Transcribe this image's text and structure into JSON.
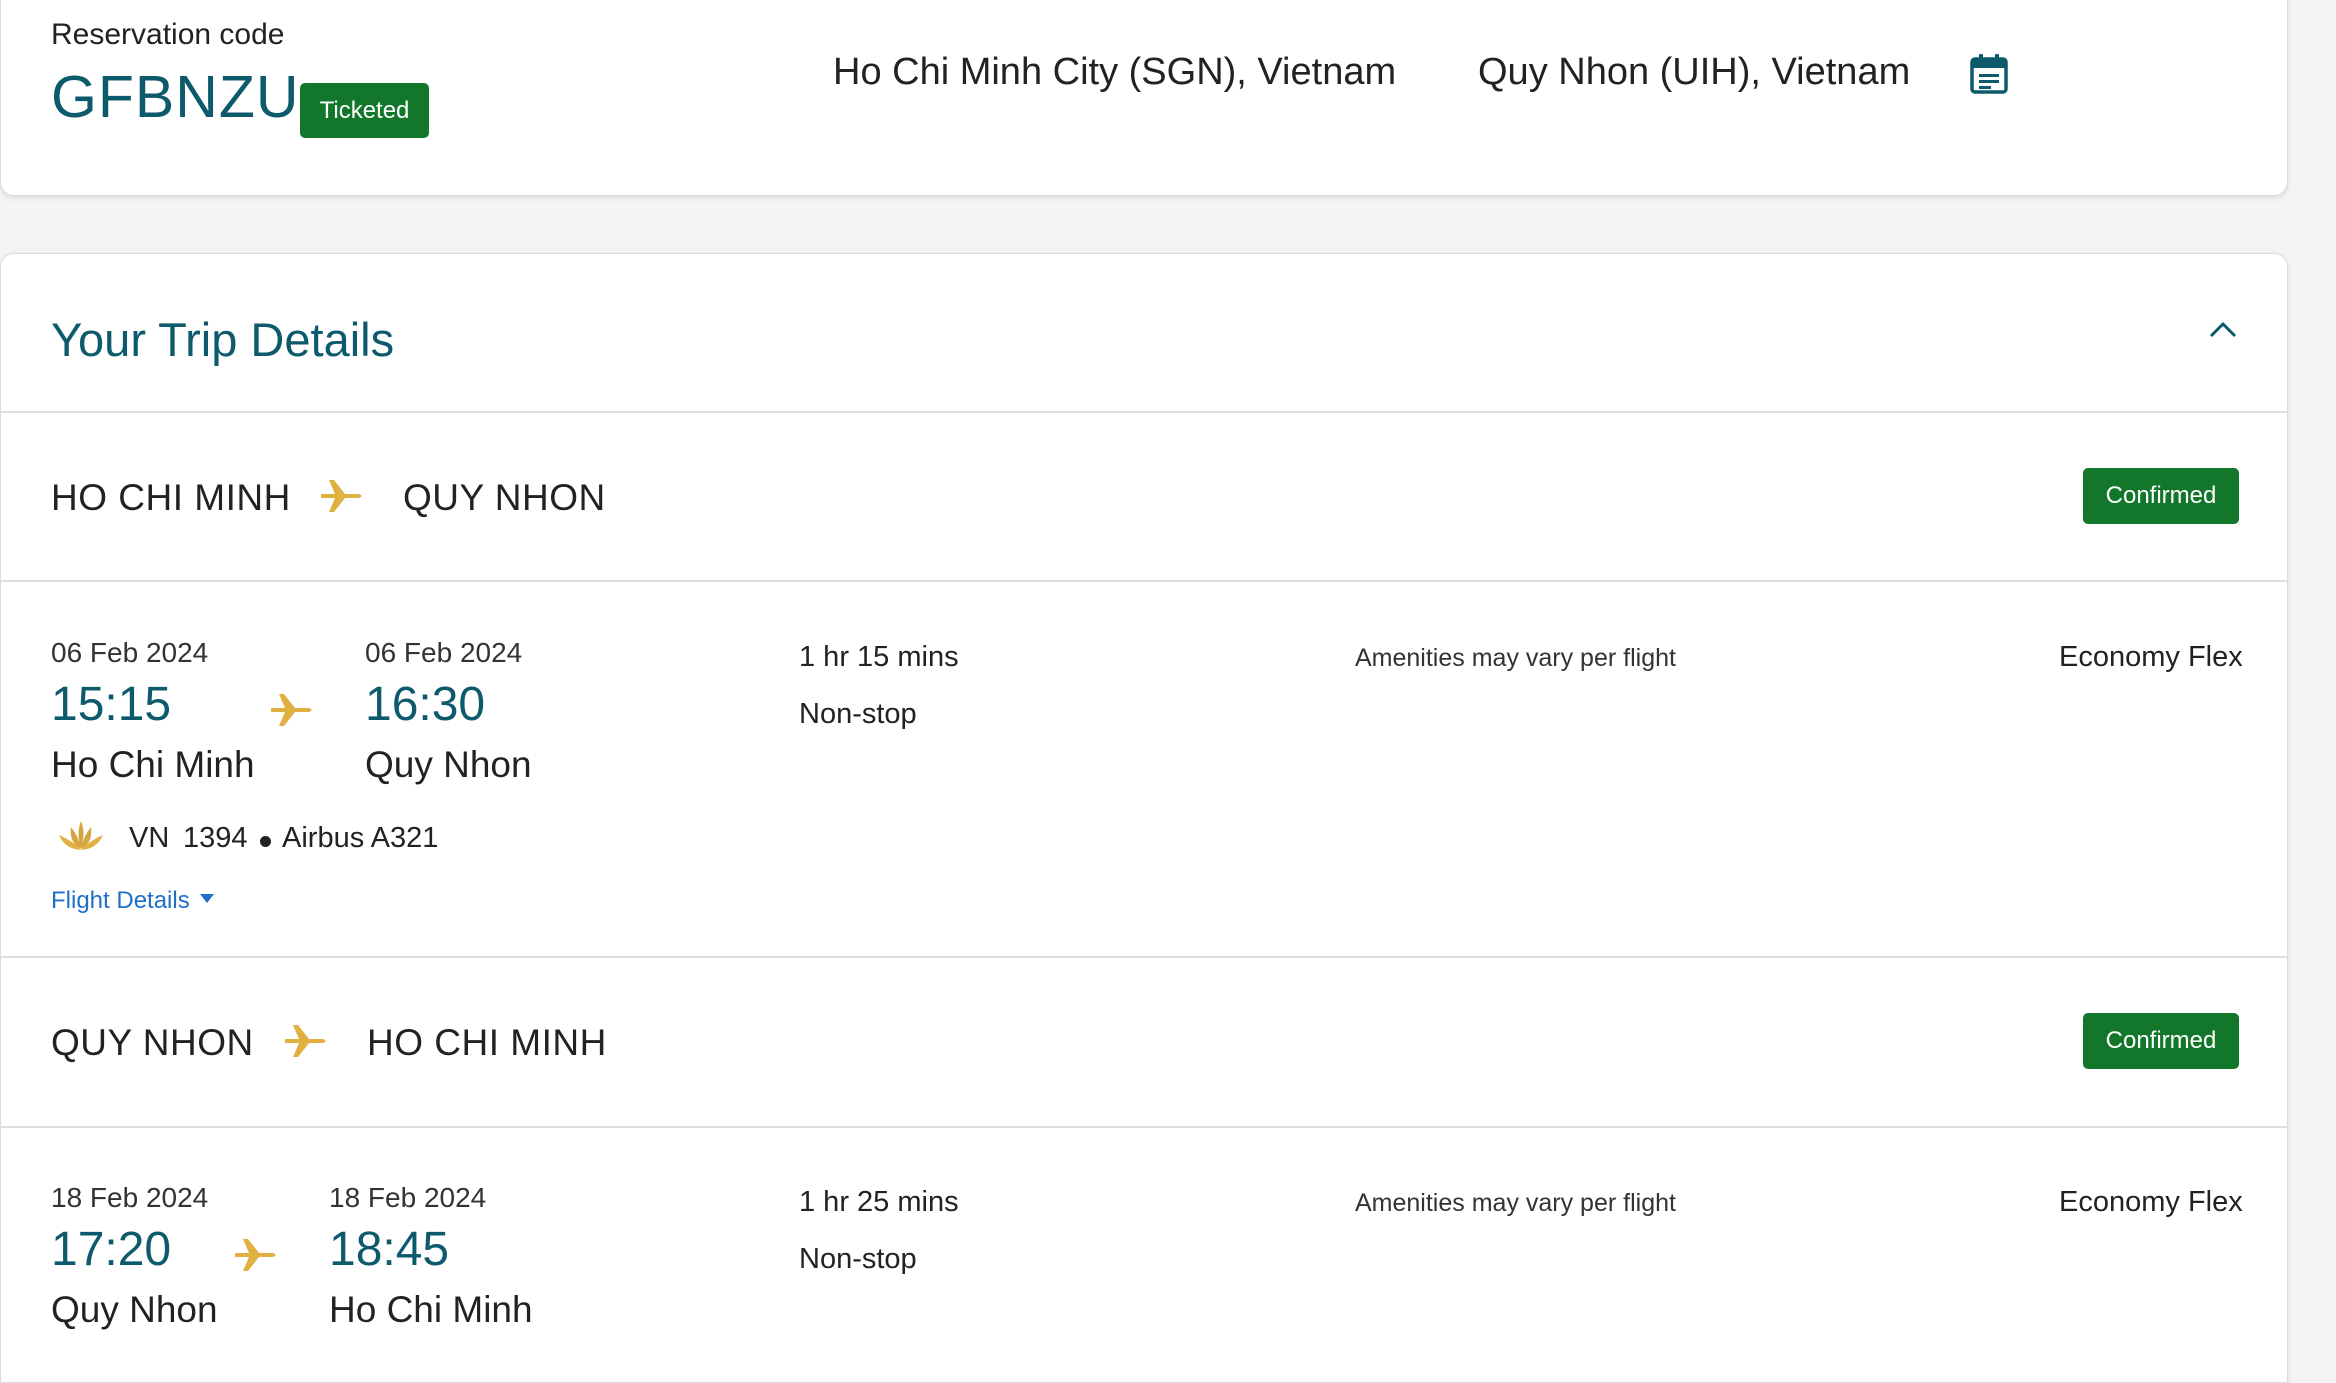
{
  "reservation": {
    "label": "Reservation code",
    "code": "GFBNZU",
    "status": "Ticketed",
    "origin": "Ho Chi Minh City (SGN), Vietnam",
    "destination": "Quy Nhon (UIH), Vietnam",
    "calendar_icon": "calendar-icon"
  },
  "trip": {
    "title": "Your Trip Details",
    "collapse_icon": "chevron-up-icon"
  },
  "segments": [
    {
      "route_from": "HO CHI MINH",
      "route_to": "QUY NHON",
      "status": "Confirmed",
      "dep_date": "06 Feb 2024",
      "dep_time": "15:15",
      "dep_city": "Ho Chi Minh",
      "arr_date": "06 Feb 2024",
      "arr_time": "16:30",
      "arr_city": "Quy Nhon",
      "duration": "1 hr 15 mins",
      "stops": "Non-stop",
      "amenities": "Amenities may vary per flight",
      "fare": "Economy Flex",
      "carrier": "VN",
      "flight_number": "1394",
      "aircraft": "Airbus A321",
      "details_link": "Flight Details"
    },
    {
      "route_from": "QUY NHON",
      "route_to": "HO CHI MINH",
      "status": "Confirmed",
      "dep_date": "18 Feb 2024",
      "dep_time": "17:20",
      "dep_city": "Quy Nhon",
      "arr_date": "18 Feb 2024",
      "arr_time": "18:45",
      "arr_city": "Ho Chi Minh",
      "duration": "1 hr 25 mins",
      "stops": "Non-stop",
      "amenities": "Amenities may vary per flight",
      "fare": "Economy Flex"
    }
  ],
  "colors": {
    "brand_teal": "#0d5a6d",
    "status_green": "#12762b",
    "plane_gold": "#e0b040",
    "link_blue": "#1f6fc9"
  }
}
